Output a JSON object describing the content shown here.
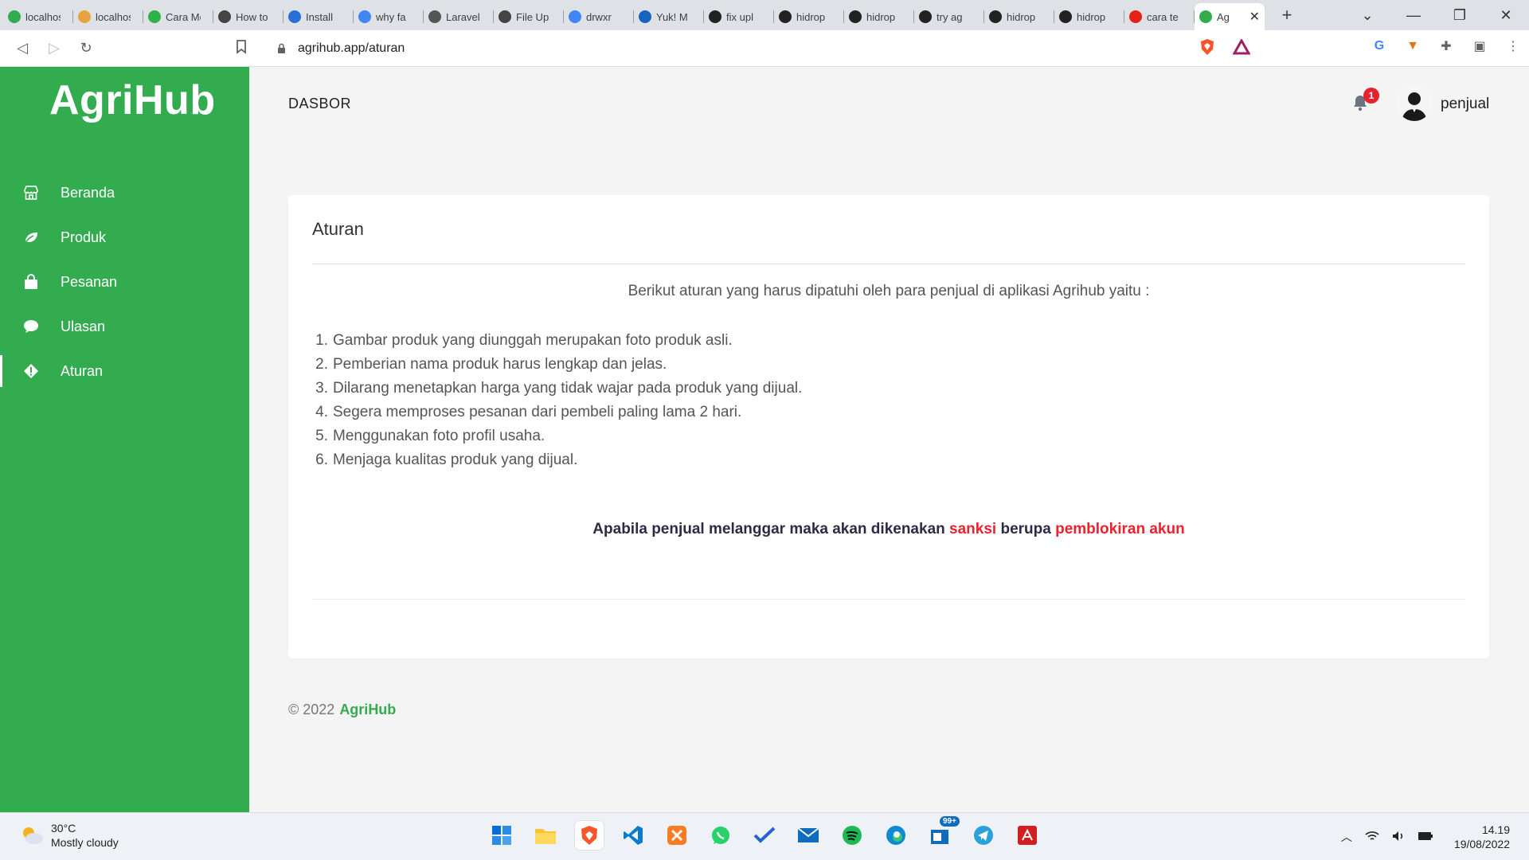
{
  "browser": {
    "tabs": [
      {
        "label": "localhost",
        "color": "#33ac50"
      },
      {
        "label": "localhost",
        "color": "#e8a33d"
      },
      {
        "label": "Cara Membuat",
        "color": "#2db34a"
      },
      {
        "label": "How to",
        "color": "#444"
      },
      {
        "label": "Install",
        "color": "#2a6fd6"
      },
      {
        "label": "why fa",
        "color": "#4285f4"
      },
      {
        "label": "Laravel",
        "color": "#555"
      },
      {
        "label": "File Up",
        "color": "#444"
      },
      {
        "label": "drwxr",
        "color": "#4285f4"
      },
      {
        "label": "Yuk! M",
        "color": "#1565c0"
      },
      {
        "label": "fix upl",
        "color": "#222"
      },
      {
        "label": "hidrop",
        "color": "#222"
      },
      {
        "label": "hidrop",
        "color": "#222"
      },
      {
        "label": "try ag",
        "color": "#222"
      },
      {
        "label": "hidrop",
        "color": "#222"
      },
      {
        "label": "hidrop",
        "color": "#222"
      },
      {
        "label": "cara te",
        "color": "#e62117"
      }
    ],
    "active_tab": {
      "label": "Ag",
      "color": "#33ac50"
    },
    "url": "agrihub.app/aturan"
  },
  "app": {
    "logo": "AgriHub",
    "menu": [
      {
        "label": "Beranda",
        "icon": "store-icon"
      },
      {
        "label": "Produk",
        "icon": "leaf-icon"
      },
      {
        "label": "Pesanan",
        "icon": "bag-icon"
      },
      {
        "label": "Ulasan",
        "icon": "chat-icon"
      },
      {
        "label": "Aturan",
        "icon": "info-diamond-icon"
      }
    ],
    "page_header": "DASBOR",
    "notification_count": "1",
    "username": "penjual",
    "card": {
      "title": "Aturan",
      "intro": "Berikut aturan yang harus dipatuhi oleh para penjual di aplikasi Agrihub yaitu :",
      "rules": [
        "Gambar produk yang diunggah merupakan foto produk asli.",
        "Pemberian nama produk harus lengkap dan jelas.",
        "Dilarang menetapkan harga yang tidak wajar pada produk yang dijual.",
        "Segera memproses pesanan dari pembeli paling lama 2 hari.",
        "Menggunakan foto profil usaha.",
        "Menjaga kualitas produk yang dijual."
      ],
      "warning_prefix": "Apabila penjual melanggar maka akan dikenakan ",
      "warning_sanksi": "sanksi",
      "warning_mid": " berupa ",
      "warning_block": "pemblokiran akun"
    },
    "footer": {
      "copy": "© 2022",
      "brand": "AgriHub"
    }
  },
  "taskbar": {
    "temperature": "30°C",
    "weather": "Mostly cloudy",
    "time": "14.19",
    "date": "19/08/2022",
    "mail_badge": "99+"
  }
}
